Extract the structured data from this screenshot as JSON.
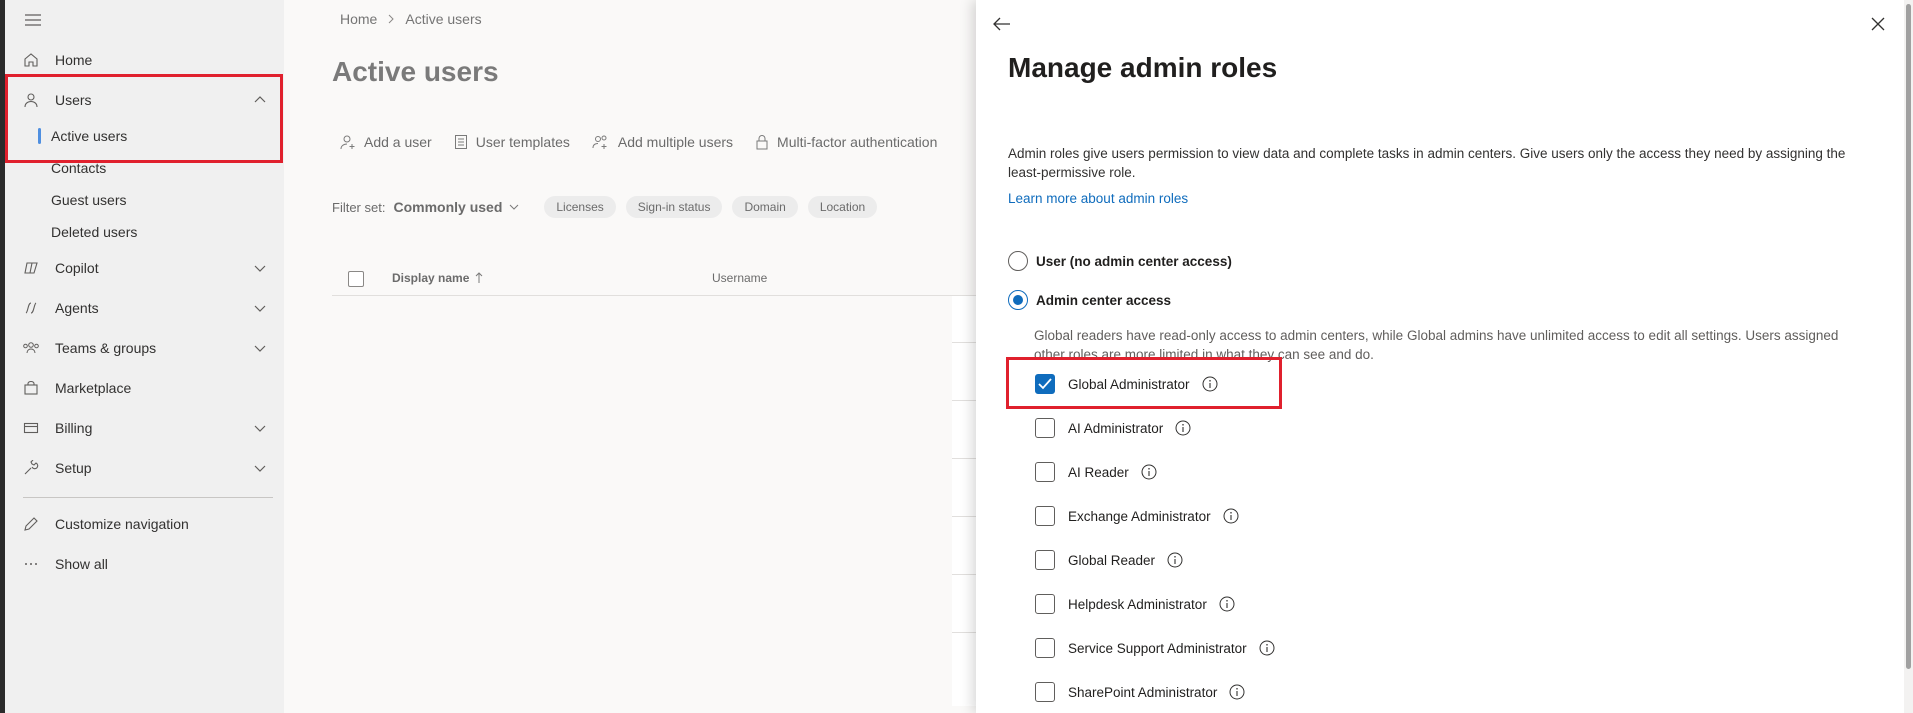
{
  "nav": {
    "items": [
      {
        "key": "home",
        "label": "Home"
      },
      {
        "key": "users",
        "label": "Users"
      },
      {
        "key": "copilot",
        "label": "Copilot"
      },
      {
        "key": "agents",
        "label": "Agents"
      },
      {
        "key": "teams",
        "label": "Teams & groups"
      },
      {
        "key": "marketplace",
        "label": "Marketplace"
      },
      {
        "key": "billing",
        "label": "Billing"
      },
      {
        "key": "setup",
        "label": "Setup"
      },
      {
        "key": "customize",
        "label": "Customize navigation"
      },
      {
        "key": "showall",
        "label": "Show all"
      }
    ],
    "users_sub": [
      "Active users",
      "Contacts",
      "Guest users",
      "Deleted users"
    ]
  },
  "main": {
    "breadcrumb": [
      "Home",
      "Active users"
    ],
    "title": "Active users",
    "commands": [
      "Add a user",
      "User templates",
      "Add multiple users",
      "Multi-factor authentication"
    ],
    "filter_label": "Filter set:",
    "filter_value": "Commonly used",
    "filters": [
      "Licenses",
      "Sign-in status",
      "Domain",
      "Location"
    ],
    "columns": [
      "Display name",
      "Username"
    ]
  },
  "panel": {
    "title": "Manage admin roles",
    "description": "Admin roles give users permission to view data and complete tasks in admin centers. Give users only the access they need by assigning the least-permissive role.",
    "link": "Learn more about admin roles",
    "options": [
      {
        "label": "User (no admin center access)",
        "checked": false
      },
      {
        "label": "Admin center access",
        "checked": true
      }
    ],
    "access_note": "Global readers have read-only access to admin centers, while Global admins have unlimited access to edit all settings. Users assigned other roles are more limited in what they can see and do.",
    "roles": [
      {
        "label": "Global Administrator",
        "checked": true
      },
      {
        "label": "AI Administrator",
        "checked": false
      },
      {
        "label": "AI Reader",
        "checked": false
      },
      {
        "label": "Exchange Administrator",
        "checked": false
      },
      {
        "label": "Global Reader",
        "checked": false
      },
      {
        "label": "Helpdesk Administrator",
        "checked": false
      },
      {
        "label": "Service Support Administrator",
        "checked": false
      },
      {
        "label": "SharePoint Administrator",
        "checked": false
      }
    ]
  },
  "colors": {
    "accent": "#0f6cbd",
    "highlight": "#e0202d",
    "nav_bg": "#f0f0f0"
  }
}
